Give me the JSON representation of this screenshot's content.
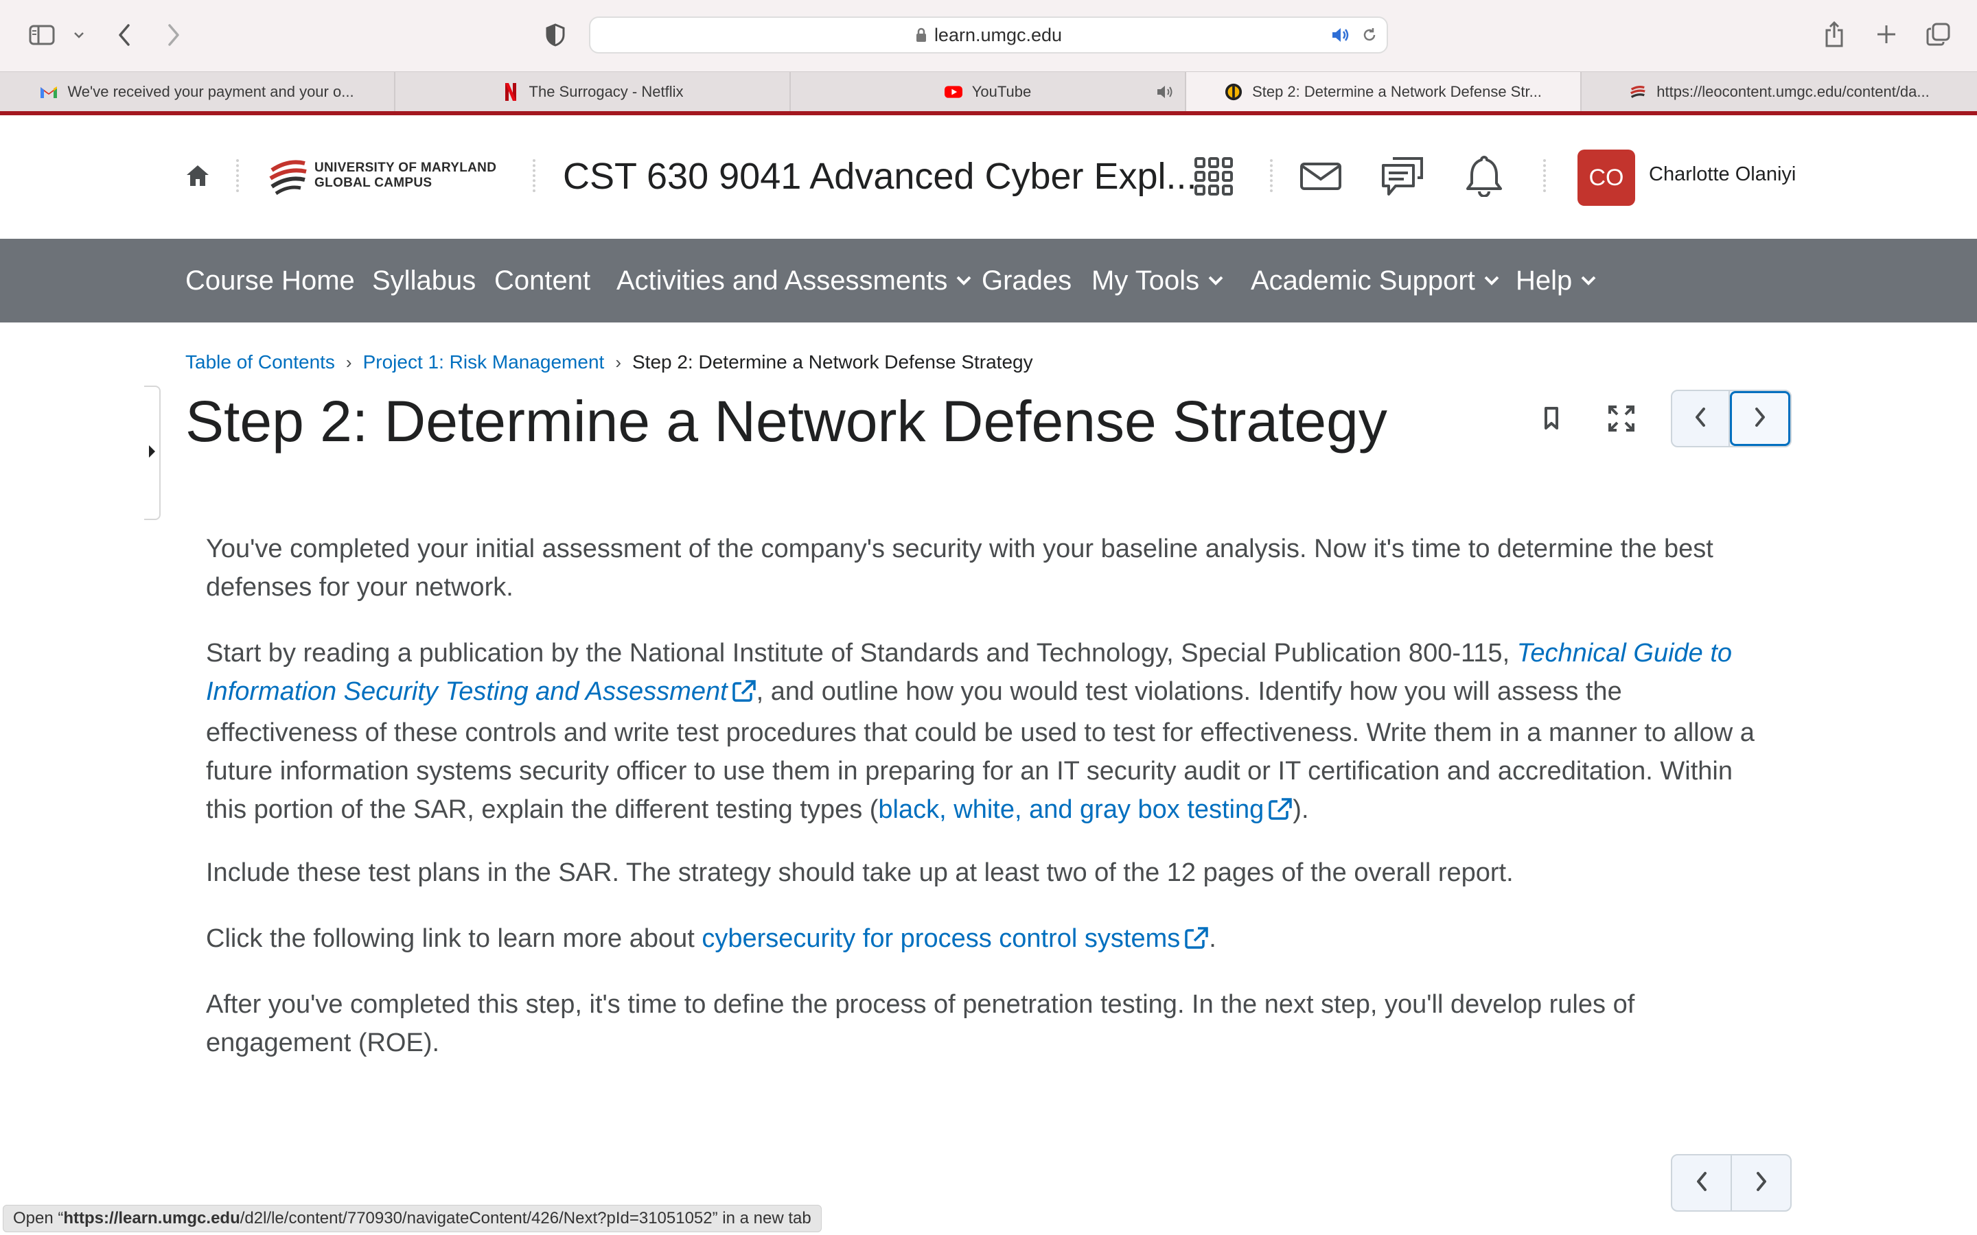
{
  "browser": {
    "address": "learn.umgc.edu",
    "tabs": [
      {
        "label": "We've received your payment and your o...",
        "icon": "gmail-icon"
      },
      {
        "label": "The Surrogacy - Netflix",
        "icon": "netflix-icon"
      },
      {
        "label": "YouTube",
        "icon": "youtube-icon",
        "audio": true
      },
      {
        "label": "Step 2: Determine a Network Defense Str...",
        "icon": "umgc-icon",
        "active": true
      },
      {
        "label": "https://leocontent.umgc.edu/content/da...",
        "icon": "umgc-logo-icon"
      }
    ]
  },
  "header": {
    "university_line1": "UNIVERSITY OF MARYLAND",
    "university_line2": "GLOBAL CAMPUS",
    "course_title": "CST 630 9041 Advanced Cyber Expl...",
    "avatar_initials": "CO",
    "avatar_color": "#c3342d",
    "user_name": "Charlotte Olaniyi"
  },
  "nav": [
    {
      "label": "Course Home",
      "dropdown": false
    },
    {
      "label": "Syllabus",
      "dropdown": false
    },
    {
      "label": "Content",
      "dropdown": false
    },
    {
      "label": "Activities and Assessments",
      "dropdown": true
    },
    {
      "label": "Grades",
      "dropdown": false
    },
    {
      "label": "My Tools",
      "dropdown": true
    },
    {
      "label": "Academic Support",
      "dropdown": true
    },
    {
      "label": "Help",
      "dropdown": true
    }
  ],
  "breadcrumb": {
    "toc": "Table of Contents",
    "project": "Project 1: Risk Management",
    "current": "Step 2: Determine a Network Defense Strategy"
  },
  "page": {
    "title": "Step 2: Determine a Network Defense Strategy",
    "p1": "You've completed your initial assessment of the company's security with your baseline analysis. Now it's time to determine the best defenses for your network.",
    "p2_a": "Start by reading a publication by the National Institute of Standards and Technology, Special Publication 800-115, ",
    "p2_link": "Technical Guide to Information Security Testing and Assessment",
    "p2_b": ", and outline how you would test violations. Identify how you will assess the effectiveness of these controls and write test procedures that could be used to test for effectiveness. Write them in a manner to allow a future information systems security officer to use them in preparing for an IT security audit or IT certification and accreditation. Within this portion of the SAR, explain the different testing types (",
    "p2_link2": "black, white, and gray box testing",
    "p2_c": ").",
    "p3": "Include these test plans in the SAR. The strategy should take up at least two of the 12 pages of the overall report.",
    "p4_a": "Click the following link to learn more about ",
    "p4_link": "cybersecurity for process control systems",
    "p4_b": ".",
    "p5": "After you've completed this step, it's time to define the process of penetration testing. In the next step, you'll develop rules of engagement (ROE)."
  },
  "status": {
    "prefix": "Open “",
    "bold": "https://learn.umgc.edu",
    "rest": "/d2l/le/content/770930/navigateContent/426/Next?pId=31051052” in a new tab"
  },
  "colors": {
    "accent_red": "#a3171f",
    "link_blue": "#006fbf",
    "nav_gray": "#6d7278"
  }
}
